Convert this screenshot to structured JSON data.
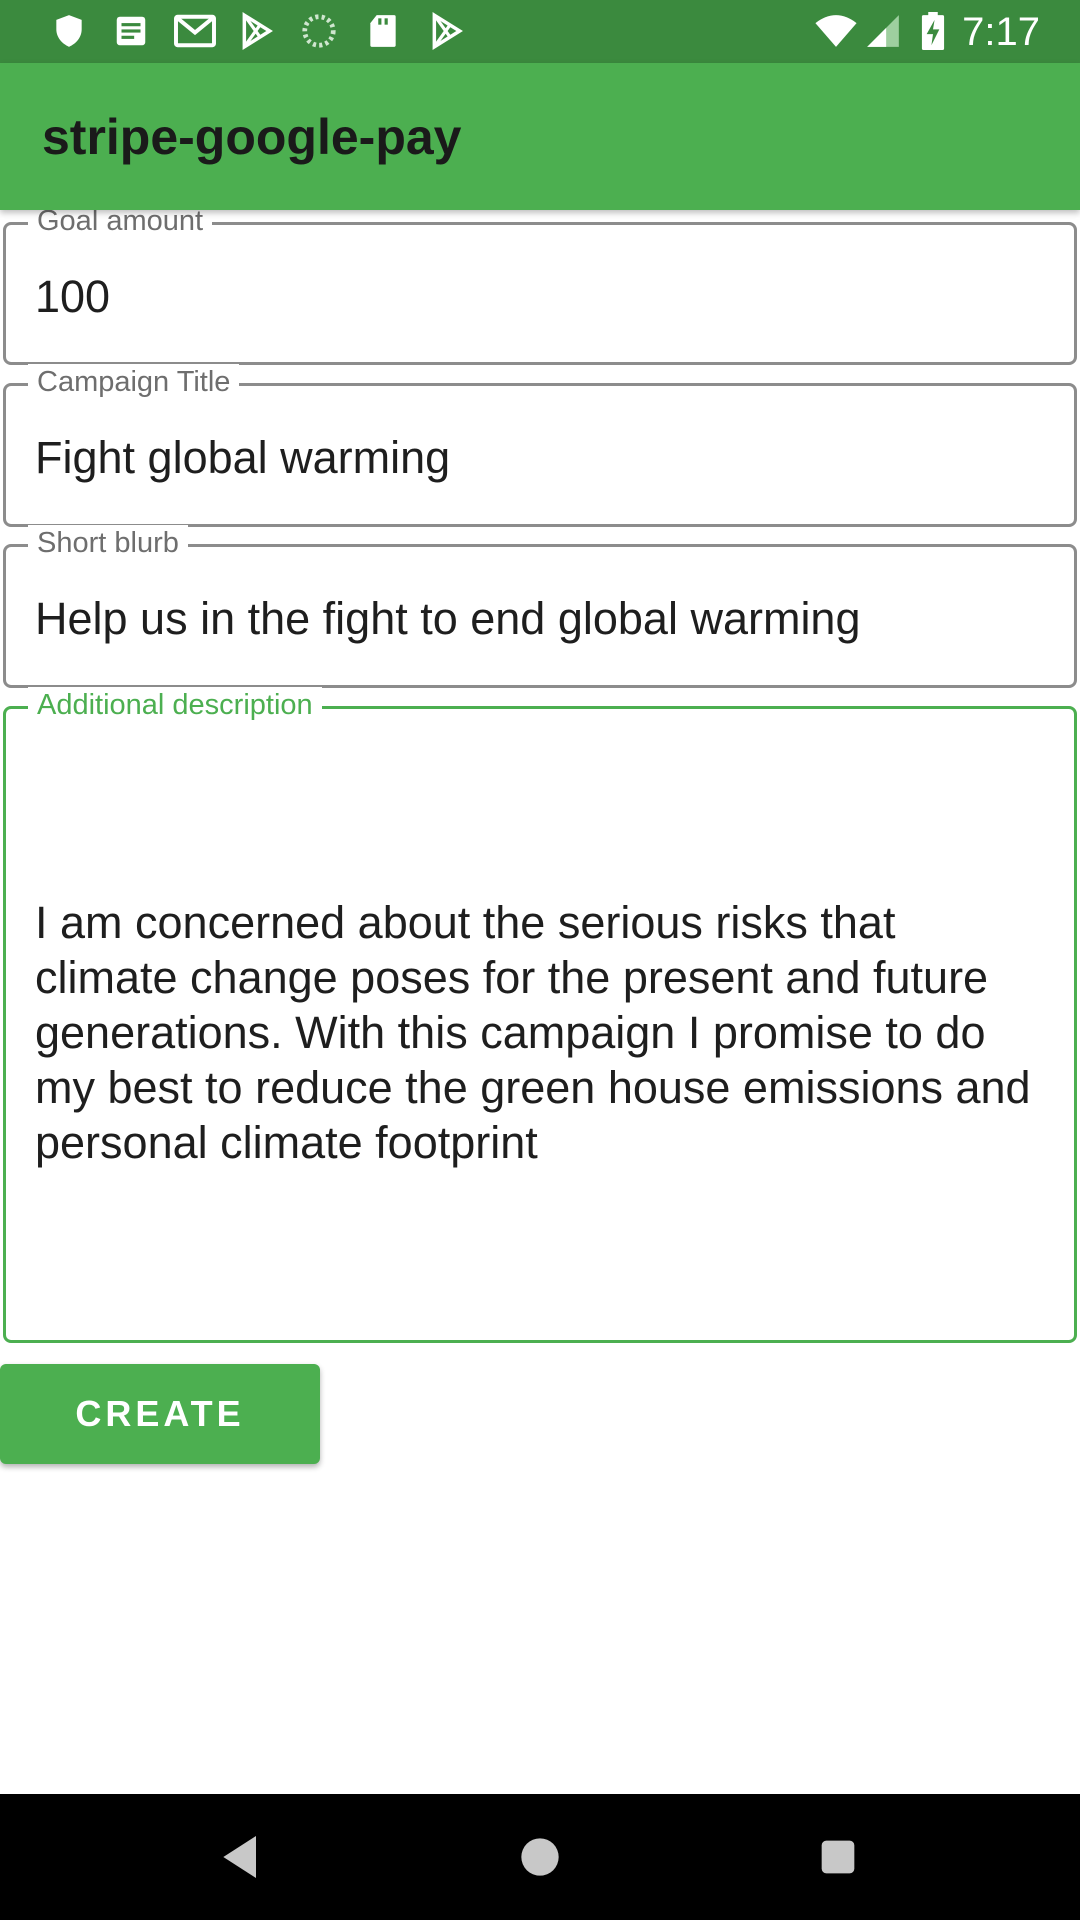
{
  "status_bar": {
    "time": "7:17",
    "left_icons": [
      "shield-icon",
      "notes-icon",
      "gmail-icon",
      "play-store-icon",
      "sync-icon",
      "sd-card-icon",
      "play-store-icon"
    ],
    "right_icons": [
      "wifi-icon",
      "signal-icon",
      "battery-charging-icon"
    ]
  },
  "app_bar": {
    "title": "stripe-google-pay"
  },
  "form": {
    "goal_amount": {
      "label": "Goal amount",
      "value": "100"
    },
    "campaign_title": {
      "label": "Campaign Title",
      "value": "Fight global warming"
    },
    "short_blurb": {
      "label": "Short blurb",
      "value": "Help us in the fight to end global warming"
    },
    "additional_description": {
      "label": "Additional description",
      "value": "I am concerned about the serious risks that climate change poses for the present and future generations. With this campaign I promise to do my best to reduce the green house emissions and personal climate footprint"
    },
    "create_label": "CREATE"
  },
  "nav_bar": {
    "buttons": [
      "back-icon",
      "home-icon",
      "recents-icon"
    ]
  },
  "colors": {
    "accent": "#4caf50",
    "status_bar": "#3b8a3e",
    "nav_bar": "#000000"
  }
}
